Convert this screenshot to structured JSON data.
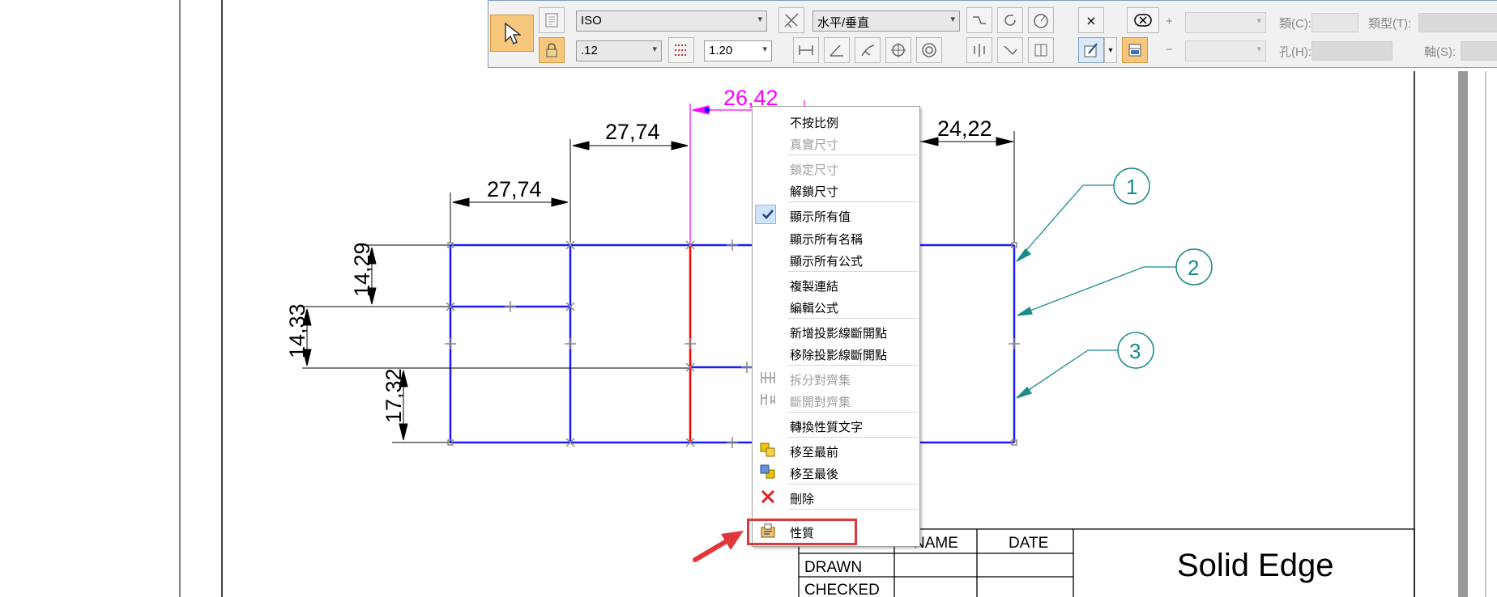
{
  "toolbar": {
    "standard": "ISO",
    "precision": ".12",
    "scale": "1.20",
    "orientation": "水平/垂直",
    "label_class": "類(C):",
    "label_type": "類型(T):",
    "label_hole": "孔(H):",
    "label_axis": "軸(S):",
    "plus": "+",
    "minus": "−",
    "close_glyph": "×"
  },
  "drawing": {
    "dims": [
      "26,42",
      "27,74",
      "27,74",
      "24,22",
      "14,29",
      "14,33",
      "17,32"
    ],
    "balloons": [
      "1",
      "2",
      "3"
    ],
    "title_block": {
      "name_header": "NAME",
      "date_header": "DATE",
      "drawn": "DRAWN",
      "checked": "CHECKED",
      "product": "Solid Edge"
    }
  },
  "context_menu": {
    "items": [
      {
        "label": "不按比例",
        "enabled": true
      },
      {
        "label": "真實尺寸",
        "enabled": false
      },
      {
        "label": "鎖定尺寸",
        "enabled": false
      },
      {
        "label": "解鎖尺寸",
        "enabled": true
      },
      {
        "label": "顯示所有值",
        "enabled": true,
        "checked": true
      },
      {
        "label": "顯示所有名稱",
        "enabled": true
      },
      {
        "label": "顯示所有公式",
        "enabled": true
      },
      {
        "label": "複製連結",
        "enabled": true
      },
      {
        "label": "編輯公式",
        "enabled": true
      },
      {
        "label": "新增投影線斷開點",
        "enabled": true
      },
      {
        "label": "移除投影線斷開點",
        "enabled": true
      },
      {
        "label": "拆分對齊集",
        "enabled": false
      },
      {
        "label": "斷開對齊集",
        "enabled": false
      },
      {
        "label": "轉換性質文字",
        "enabled": true
      },
      {
        "label": "移至最前",
        "enabled": true
      },
      {
        "label": "移至最後",
        "enabled": true
      },
      {
        "label": "刪除",
        "enabled": true
      },
      {
        "label": "性質",
        "enabled": true,
        "highlighted": true
      }
    ]
  },
  "colors": {
    "geometry": "#1a1aff",
    "selected": "#ff0000",
    "active_dim": "#ff00ff",
    "balloon": "#1a8a8a",
    "annotation": "#e2373a"
  }
}
